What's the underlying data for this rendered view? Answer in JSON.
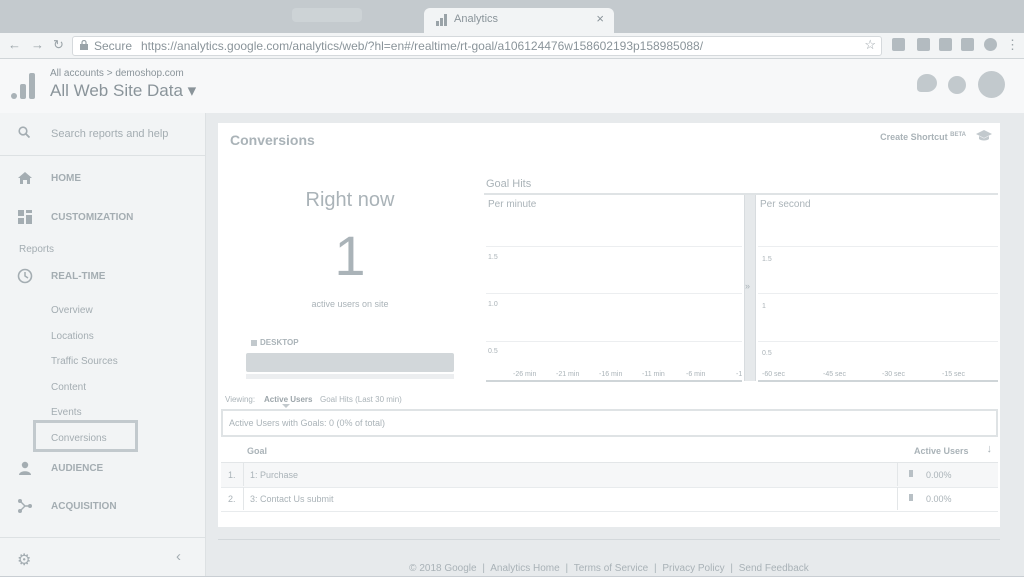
{
  "browser": {
    "tab_title": "Analytics",
    "tab_close": "×",
    "secure_label": "Secure",
    "url": "https://analytics.google.com/analytics/web/?hl=en#/realtime/rt-goal/a106124476w158602193p158985088/"
  },
  "header": {
    "breadcrumb": "All accounts > demoshop.com",
    "view_title": "All Web Site Data",
    "view_caret": "▾"
  },
  "sidebar": {
    "search_placeholder": "Search reports and help",
    "home": "HOME",
    "customization": "CUSTOMIZATION",
    "reports_label": "Reports",
    "realtime": "REAL-TIME",
    "realtime_items": [
      "Overview",
      "Locations",
      "Traffic Sources",
      "Content",
      "Events",
      "Conversions"
    ],
    "audience": "AUDIENCE",
    "acquisition": "ACQUISITION",
    "collapse": "‹"
  },
  "report": {
    "title": "Conversions",
    "create_shortcut": "Create Shortcut",
    "beta": "BETA",
    "right_now": "Right now",
    "active_count": "1",
    "active_label": "active users on site",
    "device_label": "DESKTOP",
    "goal_hits_title": "Goal Hits",
    "per_minute": {
      "label": "Per minute",
      "y_ticks": [
        "1.5",
        "1.0",
        "0.5"
      ],
      "x_ticks": [
        "-26 min",
        "-21 min",
        "-16 min",
        "-11 min",
        "-6 min",
        "-1"
      ]
    },
    "per_second": {
      "label": "Per second",
      "y_ticks": [
        "1.5",
        "1",
        "0.5"
      ],
      "x_ticks": [
        "-60 sec",
        "-45 sec",
        "-30 sec",
        "-15 sec"
      ]
    },
    "splitter_arrow": "»",
    "viewing_label": "Viewing:",
    "view_active": "Active Users",
    "view_goal_hits": "Goal Hits (Last 30 min)",
    "summary": "Active Users with Goals: 0 (0% of total)",
    "table": {
      "col_goal": "Goal",
      "col_active": "Active Users",
      "sort_arrow": "↓",
      "rows": [
        {
          "index": "1.",
          "goal": "1: Purchase",
          "pct": "0.00%"
        },
        {
          "index": "2.",
          "goal": "3: Contact Us submit",
          "pct": "0.00%"
        }
      ]
    }
  },
  "footer": {
    "copyright": "© 2018 Google",
    "links": [
      "Analytics Home",
      "Terms of Service",
      "Privacy Policy",
      "Send Feedback"
    ],
    "separator": "|"
  }
}
